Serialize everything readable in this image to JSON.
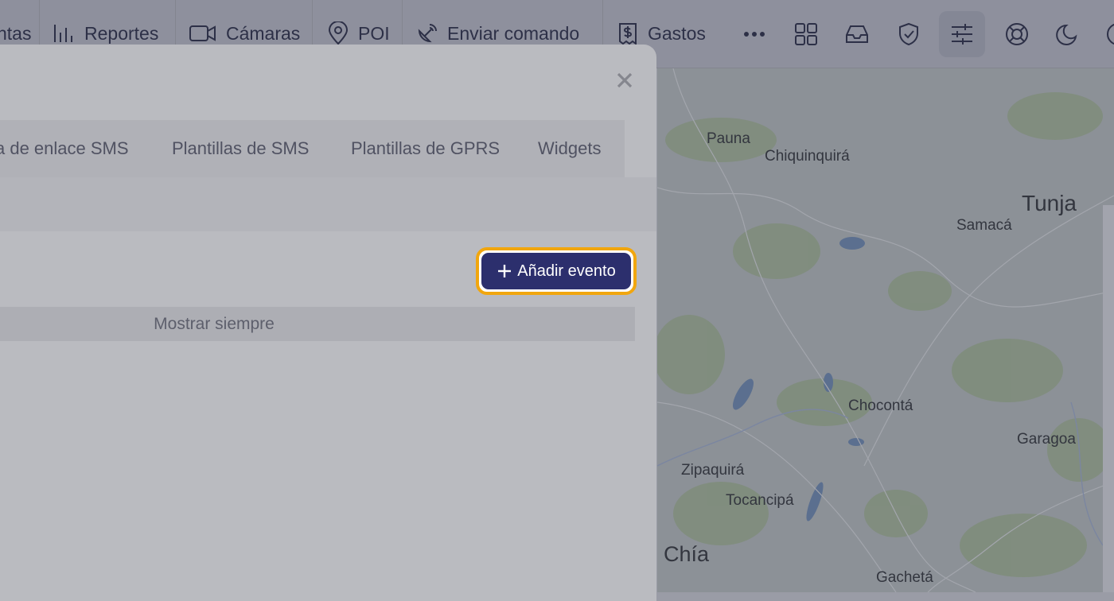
{
  "nav": {
    "items": [
      {
        "label": "ntas",
        "icon": "none"
      },
      {
        "label": "Reportes",
        "icon": "bar-chart-icon"
      },
      {
        "label": "Cámaras",
        "icon": "video-camera-icon"
      },
      {
        "label": "POI",
        "icon": "map-pin-icon"
      },
      {
        "label": "Enviar comando",
        "icon": "satellite-dish-icon"
      },
      {
        "label": "Gastos",
        "icon": "receipt-icon"
      }
    ],
    "icons": [
      "more-icon",
      "apps-grid-icon",
      "inbox-icon",
      "shield-check-icon",
      "sliders-icon",
      "lifebuoy-icon",
      "moon-icon",
      "circle-icon"
    ]
  },
  "modal": {
    "tabs": [
      "a de enlace SMS",
      "Plantillas de SMS",
      "Plantillas de GPRS",
      "Widgets"
    ],
    "add_button_label": "Añadir evento",
    "table_column": "Mostrar siempre",
    "close_icon": "close-icon"
  },
  "map": {
    "cities": [
      "Pauna",
      "Chiquinquirá",
      "Tunja",
      "Samacá",
      "Chocontá",
      "Garagoa",
      "Zipaquirá",
      "Tocancipá",
      "Chía",
      "Gachetá"
    ]
  },
  "colors": {
    "accent": "#2c2f6d",
    "highlight": "#f1a60e"
  }
}
